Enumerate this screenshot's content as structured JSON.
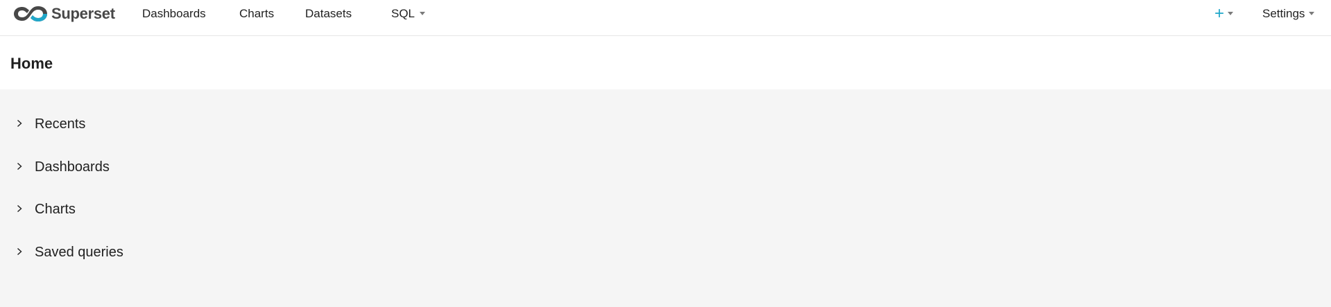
{
  "brand": {
    "name": "Superset"
  },
  "nav": {
    "items": [
      {
        "label": "Dashboards"
      },
      {
        "label": "Charts"
      },
      {
        "label": "Datasets"
      },
      {
        "label": "SQL"
      }
    ],
    "settings_label": "Settings",
    "plus_label": "+"
  },
  "header": {
    "title": "Home"
  },
  "sections": [
    {
      "label": "Recents"
    },
    {
      "label": "Dashboards"
    },
    {
      "label": "Charts"
    },
    {
      "label": "Saved queries"
    }
  ],
  "colors": {
    "accent": "#20a7c9",
    "brand_dark": "#484848",
    "content_bg": "#f5f5f5"
  },
  "icons": {
    "logo": "superset-infinity-logo-icon",
    "section_toggle": "chevron-right-icon",
    "dropdown": "caret-down-icon"
  }
}
